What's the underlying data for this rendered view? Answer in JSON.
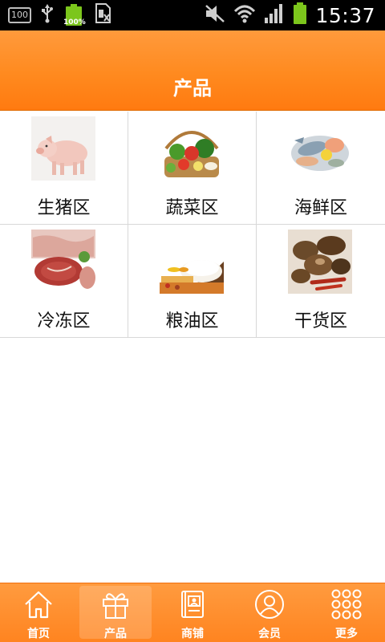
{
  "status_bar": {
    "notif_badge": "100",
    "battery_small": "100%",
    "clock": "15:37"
  },
  "header": {
    "title": "产品"
  },
  "products": [
    {
      "label": "生猪区",
      "icon": "pig-photo"
    },
    {
      "label": "蔬菜区",
      "icon": "vegetables-photo"
    },
    {
      "label": "海鲜区",
      "icon": "seafood-photo"
    },
    {
      "label": "冷冻区",
      "icon": "frozen-meat-photo"
    },
    {
      "label": "粮油区",
      "icon": "grain-oil-photo"
    },
    {
      "label": "干货区",
      "icon": "dried-goods-photo"
    }
  ],
  "bottom_nav": {
    "items": [
      {
        "label": "首页",
        "icon": "home-icon",
        "active": false
      },
      {
        "label": "产品",
        "icon": "gift-icon",
        "active": true
      },
      {
        "label": "商铺",
        "icon": "shop-icon",
        "active": false
      },
      {
        "label": "会员",
        "icon": "member-icon",
        "active": false
      },
      {
        "label": "更多",
        "icon": "more-grid-icon",
        "active": false
      }
    ]
  },
  "colors": {
    "accent": "#ff8a1f",
    "divider": "#d8d8d8"
  }
}
